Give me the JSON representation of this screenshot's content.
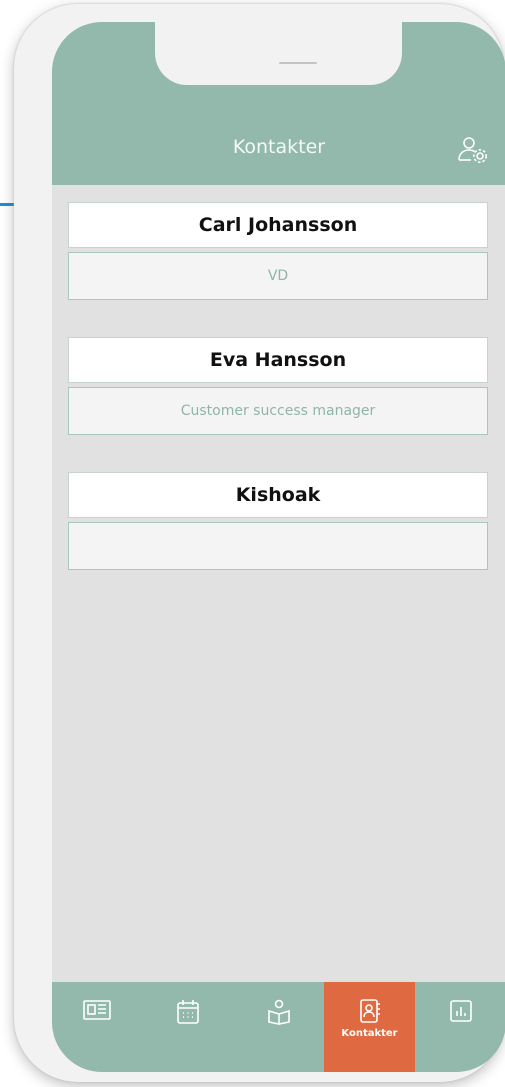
{
  "header": {
    "title": "Kontakter"
  },
  "contacts": [
    {
      "name": "Carl Johansson",
      "role": "VD"
    },
    {
      "name": "Eva Hansson",
      "role": "Customer success manager"
    },
    {
      "name": "Kishoak",
      "role": ""
    }
  ],
  "tabbar": {
    "tabs": [
      {
        "icon": "news-icon",
        "label": ""
      },
      {
        "icon": "calendar-icon",
        "label": ""
      },
      {
        "icon": "reading-person-icon",
        "label": ""
      },
      {
        "icon": "contact-book-icon",
        "label": "Kontakter",
        "active": true
      },
      {
        "icon": "bar-chart-icon",
        "label": ""
      }
    ]
  },
  "colors": {
    "header": "#93b8ac",
    "active_tab": "#df6a41",
    "role_text": "#8fb5a8",
    "accent_line": "#1e8ee0"
  }
}
